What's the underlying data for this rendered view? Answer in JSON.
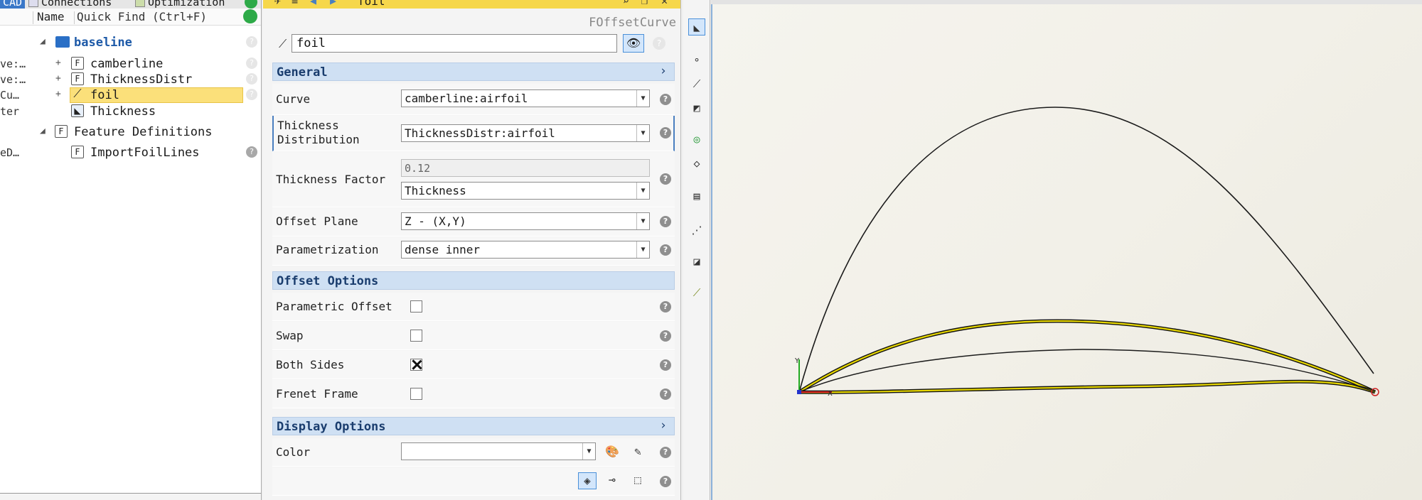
{
  "left_panel": {
    "tabs": [
      "CAD",
      "Connections",
      "Optimization"
    ],
    "header": {
      "col_name": "Name",
      "quick_find": "Quick Find (Ctrl+F)"
    },
    "left_clipped": [
      "ve:…",
      "ve:…",
      "Cu…",
      "ter",
      "eD…"
    ],
    "tree": [
      {
        "label": "baseline",
        "icon": "folder-icon",
        "level": 1,
        "expander": "◢"
      },
      {
        "label": "camberline",
        "icon": "feature-icon",
        "level": 2,
        "expander": "+"
      },
      {
        "label": "ThicknessDistr",
        "icon": "feature-icon",
        "level": 2,
        "expander": "+"
      },
      {
        "label": "foil",
        "icon": "curve-icon",
        "level": 2,
        "expander": "+",
        "selected": true
      },
      {
        "label": "Thickness",
        "icon": "scalar-icon",
        "level": 2
      },
      {
        "label": "Feature Definitions",
        "icon": "feature-icon",
        "level": 1,
        "expander": "◢"
      },
      {
        "label": "ImportFoilLines",
        "icon": "feature-icon",
        "level": 2
      }
    ]
  },
  "properties": {
    "title": "foil",
    "type": "FOffsetCurve",
    "name_value": "foil",
    "sections": {
      "general": "General",
      "offset_options": "Offset Options",
      "display_options": "Display Options"
    },
    "general": {
      "curve_label": "Curve",
      "curve_value": "camberline:airfoil",
      "thickness_dist_label_1": "Thickness",
      "thickness_dist_label_2": "Distribution",
      "thickness_dist_value": "ThicknessDistr:airfoil",
      "thickness_factor_label": "Thickness Factor",
      "thickness_factor_value": "0.12",
      "thickness_factor_ref": "Thickness",
      "offset_plane_label": "Offset Plane",
      "offset_plane_value": "Z - (X,Y)",
      "parametrization_label": "Parametrization",
      "parametrization_value": "dense inner"
    },
    "offset_options": {
      "parametric_offset_label": "Parametric Offset",
      "parametric_offset": false,
      "swap_label": "Swap",
      "swap": false,
      "both_sides_label": "Both Sides",
      "both_sides": true,
      "frenet_frame_label": "Frenet Frame",
      "frenet_frame": false
    },
    "display_options": {
      "color_label": "Color",
      "color_value": ""
    }
  },
  "viewport": {
    "background": "#f2f0e8",
    "highlight_color": "#e8d800",
    "axis_x_label": "X",
    "axis_y_label": "Y"
  }
}
